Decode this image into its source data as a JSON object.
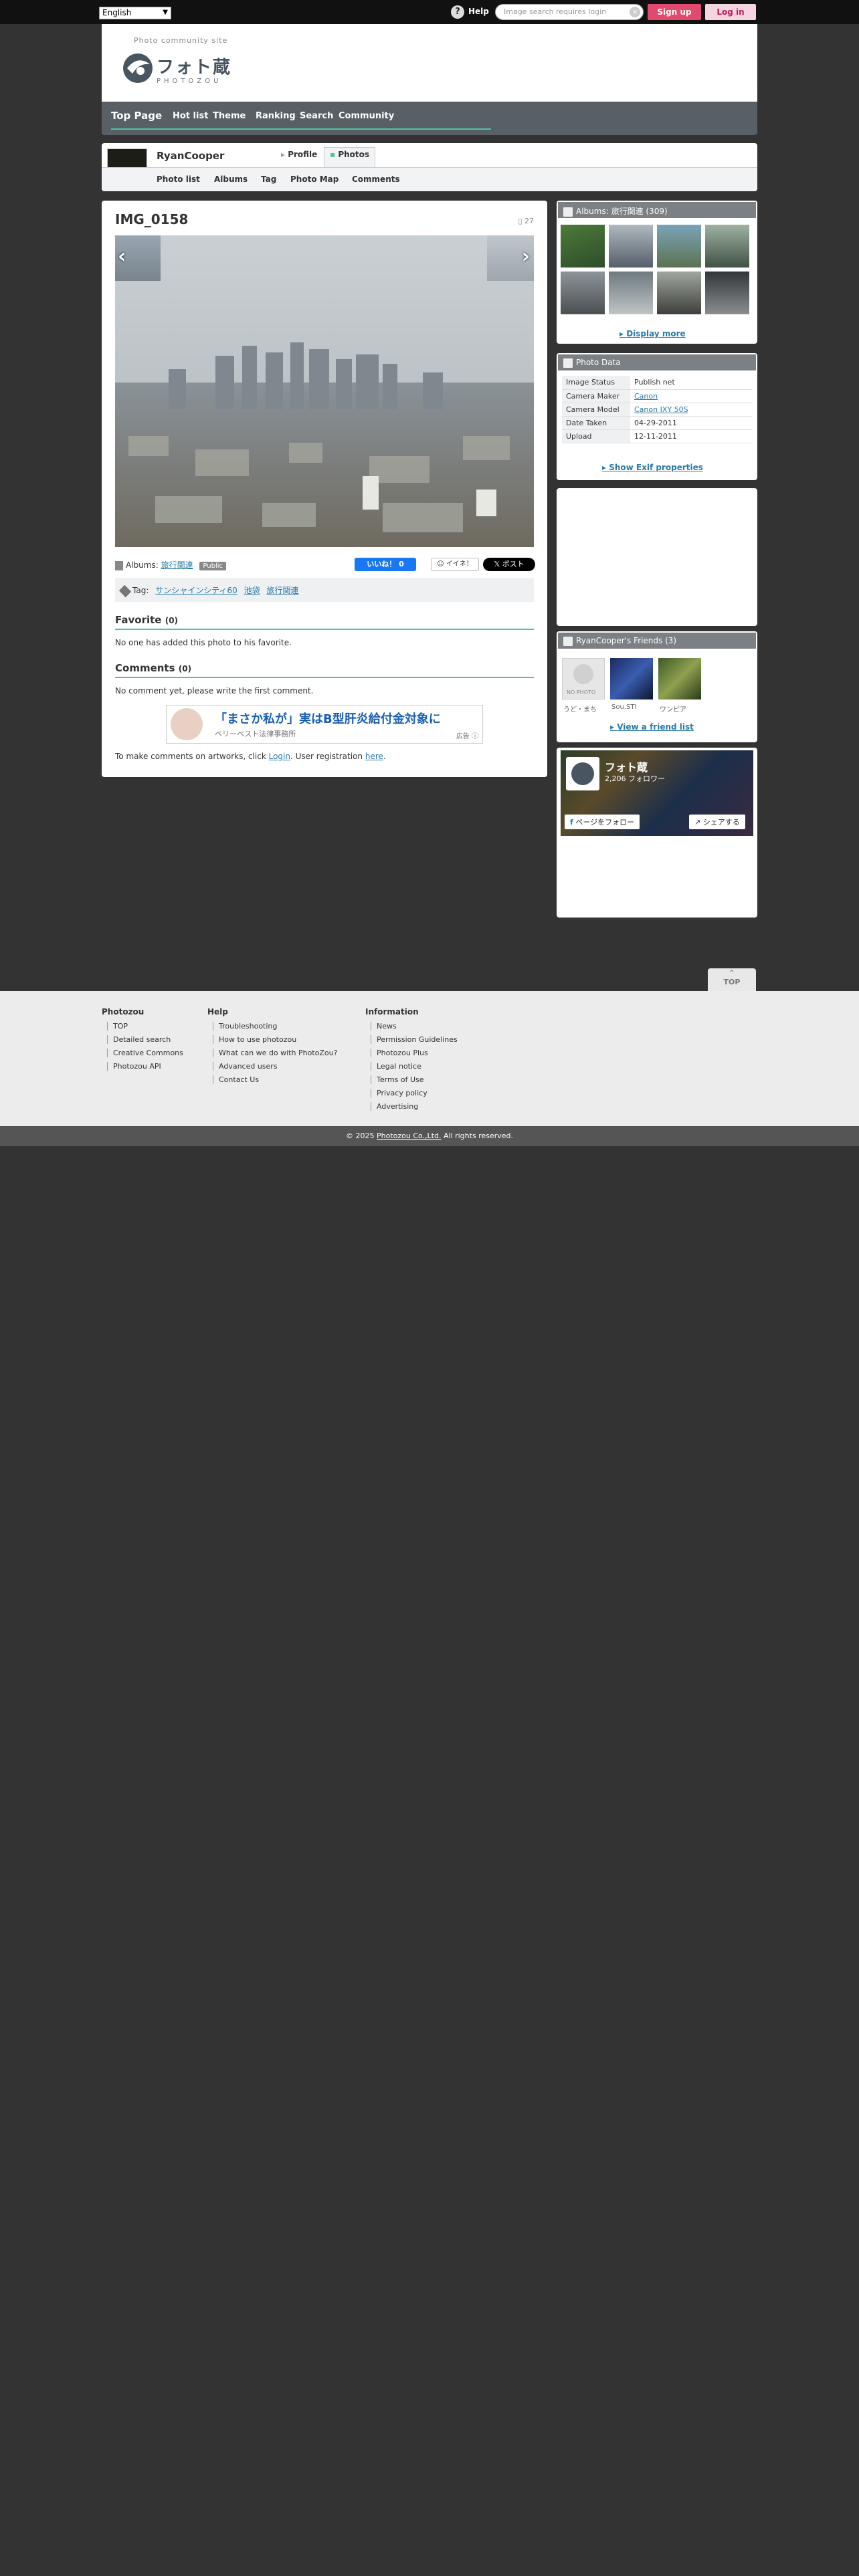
{
  "topbar": {
    "language": "English",
    "help": "Help",
    "search_placeholder": "Image search requires login",
    "signup": "Sign up",
    "login": "Log in"
  },
  "header": {
    "tagline": "Photo community site",
    "logo_text": "フォト蔵",
    "logo_sub": "PHOTOZOU"
  },
  "nav": {
    "items": [
      "Top Page",
      "Hot list",
      "Theme",
      "Ranking",
      "Search",
      "Community"
    ]
  },
  "user": {
    "name": "RyanCooper",
    "tabs": [
      "Profile",
      "Photos"
    ],
    "subnav": [
      "Photo list",
      "Albums",
      "Tag",
      "Photo Map",
      "Comments"
    ]
  },
  "photo": {
    "title": "IMG_0158",
    "views": "27",
    "album_label": "Albums:",
    "album_name": "旅行関連",
    "visibility": "Public",
    "like": "いいね！ 0",
    "iine": "イイネ！",
    "post": "ポスト",
    "tag_label": "Tag:",
    "tags": [
      "サンシャインシティ60",
      "池袋",
      "旅行関連"
    ]
  },
  "favorite": {
    "title": "Favorite",
    "count": "(0)",
    "text": "No one has added this photo to his favorite."
  },
  "comments": {
    "title": "Comments",
    "count": "(0)",
    "text": "No comment yet, please write the first comment.",
    "login_prefix": "To make comments on artworks, click",
    "login_link": "Login",
    "registration_prefix": ". User registration",
    "registration_link": "here",
    "registration_suffix": "."
  },
  "ad": {
    "main": "「まさか私が」実はB型肝炎給付金対象に",
    "sub": "ベリーベスト法律事務所",
    "label": "広告"
  },
  "sidebar": {
    "albums_title": "Albums: 旅行関連 (309)",
    "display_more": "Display more",
    "photo_data_title": "Photo Data",
    "photo_data": [
      [
        "Image Status",
        "Publish net"
      ],
      [
        "Camera Maker",
        "Canon"
      ],
      [
        "Camera Model",
        "Canon IXY 50S"
      ],
      [
        "Date Taken",
        "04-29-2011"
      ],
      [
        "Upload",
        "12-11-2011"
      ]
    ],
    "show_exif": "Show Exif properties",
    "friends_title": "RyanCooper's Friends (3)",
    "friends": [
      "うど・まち",
      "Sou.STI",
      "ワンピア"
    ],
    "no_photo": "NO PHOTO",
    "view_friends": "View a friend list",
    "fb_page": "フォト蔵",
    "fb_followers": "2,206 フォロワー",
    "fb_follow": "ページをフォロー",
    "fb_share": "シェアする"
  },
  "top_button": "TOP",
  "footer": {
    "cols": [
      {
        "head": "Photozou",
        "links": [
          "TOP",
          "Detailed search",
          "Creative Commons",
          "Photozou API"
        ]
      },
      {
        "head": "Help",
        "links": [
          "Troubleshooting",
          "How to use photozou",
          "What can we do with PhotoZou?",
          "Advanced users",
          "Contact Us"
        ]
      },
      {
        "head": "Information",
        "links": [
          "News",
          "Permission Guidelines",
          "Photozou Plus",
          "Legal notice",
          "Terms of Use",
          "Privacy policy",
          "Advertising"
        ]
      }
    ],
    "copyright_prefix": "© 2025",
    "copyright_link": "Photozou Co.,Ltd.",
    "copyright_suffix": "All rights reserved."
  }
}
